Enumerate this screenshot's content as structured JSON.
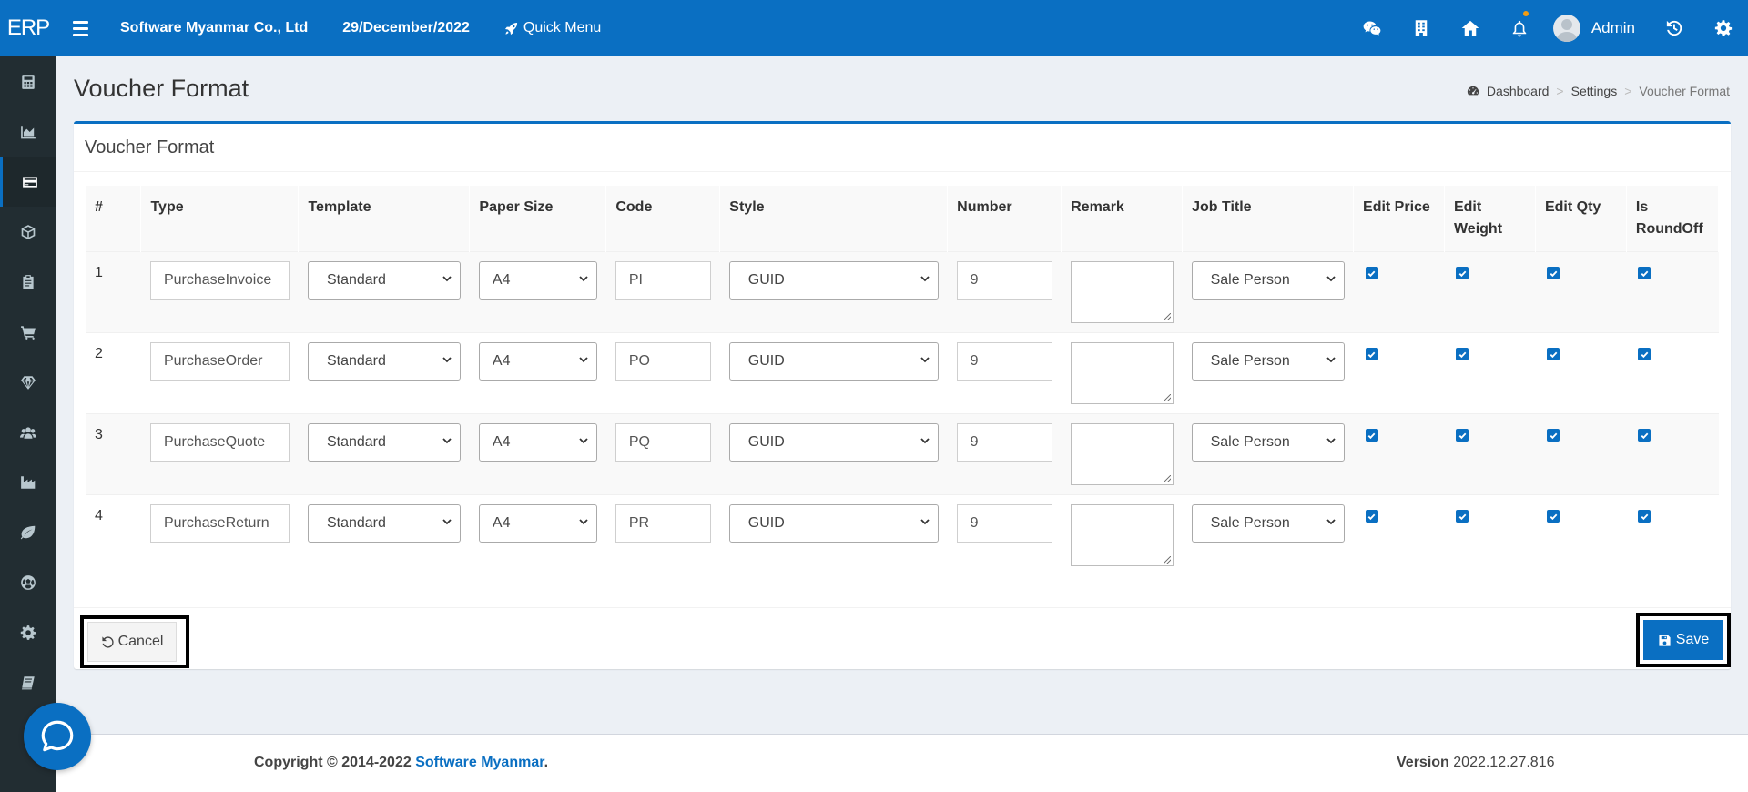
{
  "brand": {
    "logo": "ERP"
  },
  "topbar": {
    "company": "Software Myanmar Co., Ltd",
    "date": "29/December/2022",
    "quick_menu": "Quick Menu",
    "user_name": "Admin",
    "icons": [
      "wechat-icon",
      "building-icon",
      "home-icon",
      "bell-icon",
      "history-icon",
      "gear-icon"
    ]
  },
  "sidebar": {
    "icons": [
      "calculator-icon",
      "area-chart-icon",
      "credit-card-icon",
      "cube-icon",
      "clipboard-icon",
      "cart-icon",
      "diamond-icon",
      "users-icon",
      "industry-icon",
      "leaf-icon",
      "soccer-ball-icon",
      "cog-icon",
      "book-icon"
    ],
    "active_index": 2
  },
  "page": {
    "title": "Voucher Format",
    "breadcrumb": {
      "dashboard": "Dashboard",
      "settings": "Settings",
      "current": "Voucher Format"
    }
  },
  "panel": {
    "title": "Voucher Format",
    "columns": [
      "#",
      "Type",
      "Template",
      "Paper Size",
      "Code",
      "Style",
      "Number",
      "Remark",
      "Job Title",
      "Edit Price",
      "Edit Weight",
      "Edit Qty",
      "Is RoundOff"
    ],
    "rows": [
      {
        "no": "1",
        "type": "PurchaseInvoice",
        "template": "Standard",
        "paper_size": "A4",
        "code": "PI",
        "style": "GUID",
        "number": "9",
        "remark": "",
        "job_title": "Sale Person",
        "edit_price": true,
        "edit_weight": true,
        "edit_qty": true,
        "is_roundoff": true
      },
      {
        "no": "2",
        "type": "PurchaseOrder",
        "template": "Standard",
        "paper_size": "A4",
        "code": "PO",
        "style": "GUID",
        "number": "9",
        "remark": "",
        "job_title": "Sale Person",
        "edit_price": true,
        "edit_weight": true,
        "edit_qty": true,
        "is_roundoff": true
      },
      {
        "no": "3",
        "type": "PurchaseQuote",
        "template": "Standard",
        "paper_size": "A4",
        "code": "PQ",
        "style": "GUID",
        "number": "9",
        "remark": "",
        "job_title": "Sale Person",
        "edit_price": true,
        "edit_weight": true,
        "edit_qty": true,
        "is_roundoff": true
      },
      {
        "no": "4",
        "type": "PurchaseReturn",
        "template": "Standard",
        "paper_size": "A4",
        "code": "PR",
        "style": "GUID",
        "number": "9",
        "remark": "",
        "job_title": "Sale Person",
        "edit_price": true,
        "edit_weight": true,
        "edit_qty": true,
        "is_roundoff": true
      }
    ],
    "cancel_label": "Cancel",
    "save_label": "Save"
  },
  "footer": {
    "copyright_prefix": "Copyright © 2014-2022 ",
    "company_link": "Software Myanmar",
    "copyright_suffix": ".",
    "version_label": "Version",
    "version": "2022.12.27.816"
  },
  "colors": {
    "accent": "#0a6fc2",
    "sidebar": "#222d32",
    "background": "#ecf0f5"
  }
}
